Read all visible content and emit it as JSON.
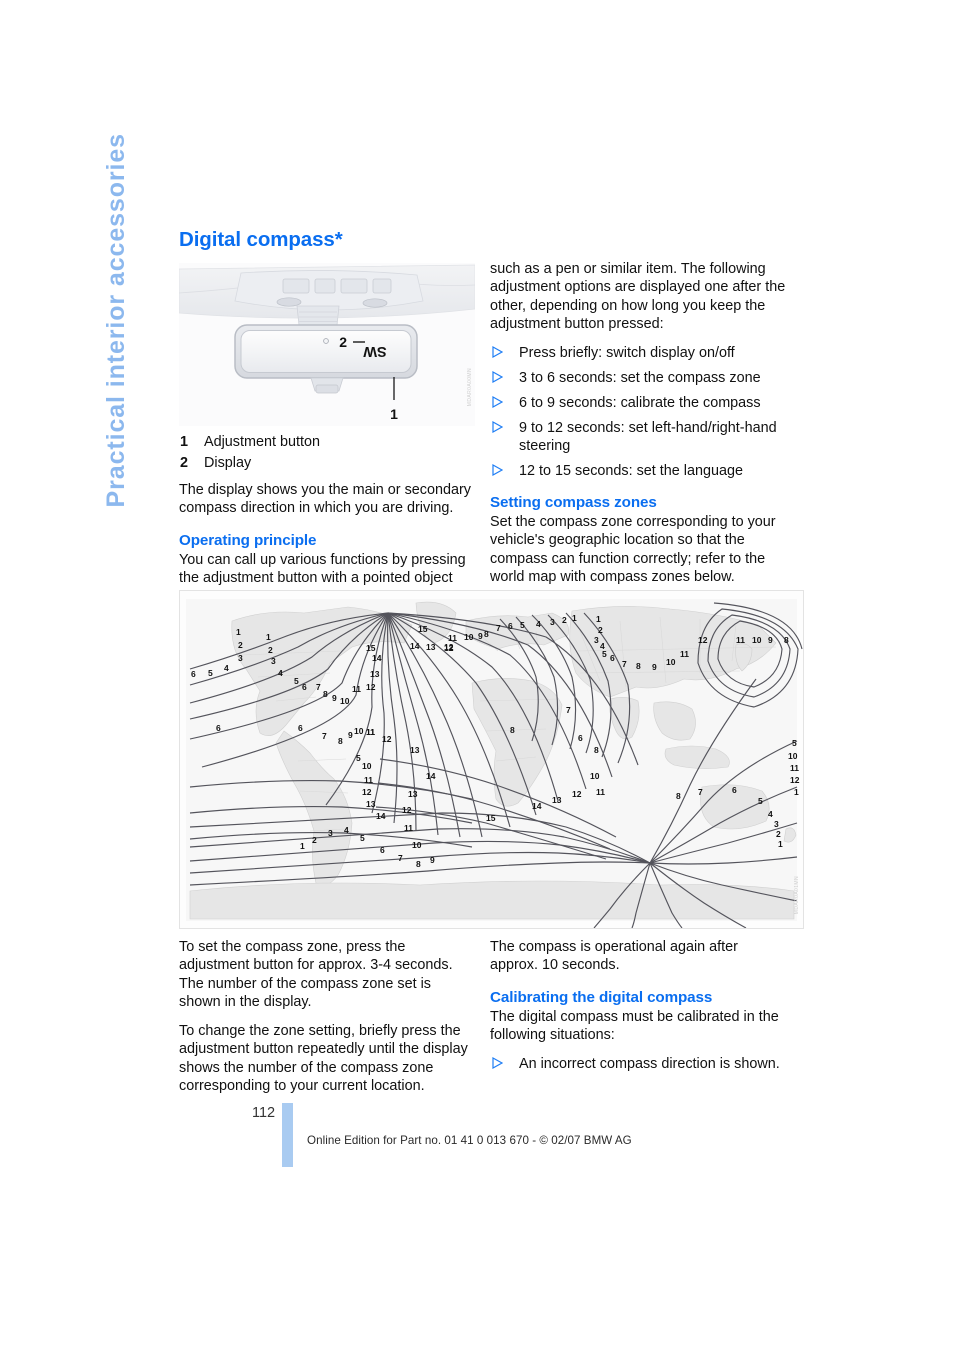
{
  "chapter_tab": "Practical interior accessories",
  "page_title": "Digital compass*",
  "figure_mirror": {
    "callout_1": "1",
    "callout_2": "2",
    "display_text": "SW",
    "code": "MDAR0A00MN"
  },
  "legend": [
    {
      "num": "1",
      "label": "Adjustment button"
    },
    {
      "num": "2",
      "label": "Display"
    }
  ],
  "left_column": {
    "intro": "The display shows you the main or secondary compass direction in which you are driving.",
    "operating_principle_heading": "Operating principle",
    "operating_principle_text": "You can call up various functions by pressing the adjustment button with a pointed object",
    "set_zone_p1": "To set the compass zone, press the adjustment button for approx. 3-4 seconds. The number of the compass zone set is shown in the display.",
    "set_zone_p2": "To change the zone setting, briefly press the adjustment button repeatedly until the display shows the number of the compass zone corresponding to your current location."
  },
  "right_column": {
    "intro": "such as a pen or similar item. The following adjustment options are displayed one after the other, depending on how long you keep the adjustment button pressed:",
    "options": [
      "Press briefly: switch display on/off",
      "3 to 6 seconds: set the compass zone",
      "6 to 9 seconds: calibrate the compass",
      "9 to 12 seconds: set left-hand/right-hand steering",
      "12 to 15 seconds: set the language"
    ],
    "setting_zones_heading": "Setting compass zones",
    "setting_zones_text": "Set the compass zone corresponding to your vehicle's geographic location so that the compass can function correctly; refer to the world map with compass zones below.",
    "operational_text": "The compass is operational again after approx. 10 seconds.",
    "calibrating_heading": "Calibrating the digital compass",
    "calibrating_text": "The digital compass must be calibrated in the following situations:",
    "calibrating_items": [
      "An incorrect compass direction is shown."
    ]
  },
  "figure_map": {
    "code": "MDAR0A01MN",
    "zone_labels": [
      "1",
      "2",
      "3",
      "4",
      "5",
      "6",
      "7",
      "8",
      "9",
      "10",
      "11",
      "12",
      "13",
      "14",
      "15"
    ]
  },
  "footer": {
    "page_number": "112",
    "text": "Online Edition for Part no. 01 41 0 013 670 - © 02/07 BMW AG"
  },
  "colors": {
    "heading_blue": "#0a6ef0",
    "tab_blue": "#8cb8ee",
    "footer_bar_blue": "#a9cbf1"
  }
}
